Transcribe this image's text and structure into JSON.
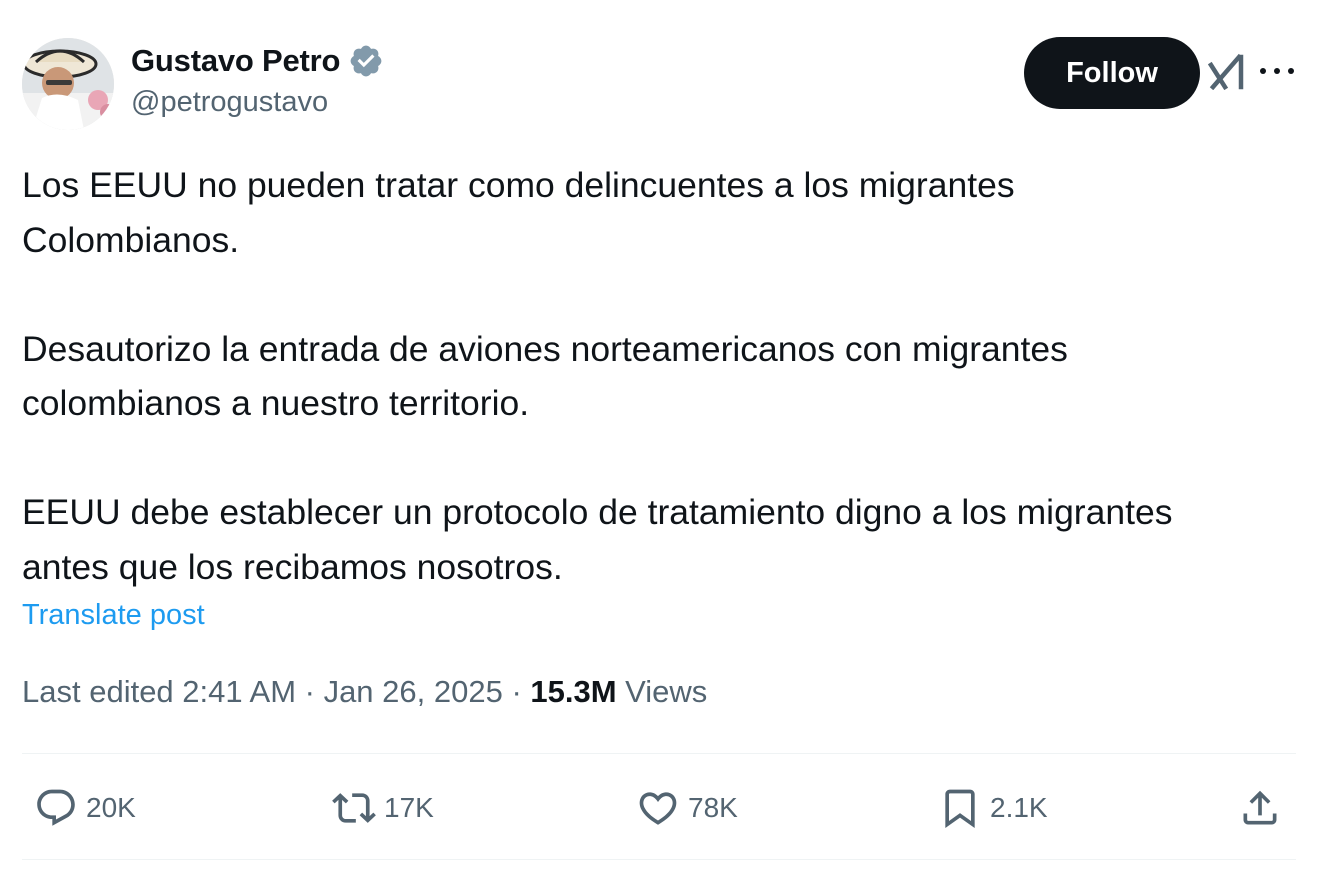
{
  "author": {
    "display_name": "Gustavo Petro",
    "handle": "@petrogustavo",
    "verified": true,
    "avatar_icon": "profile-photo"
  },
  "header": {
    "follow_label": "Follow",
    "grok_icon": "grok-icon",
    "more_icon": "more-icon"
  },
  "post": {
    "paragraphs": [
      [
        "Los EEUU no pueden tratar como delincuentes a los migrantes",
        "Colombianos."
      ],
      [
        "Desautorizo la entrada de aviones norteamericanos con migrantes",
        "colombianos a nuestro territorio."
      ],
      [
        "EEUU debe establecer un protocolo de tratamiento digno a los migrantes",
        "antes que los recibamos nosotros."
      ]
    ],
    "translate_label": "Translate post"
  },
  "meta": {
    "edited_prefix": "Last edited 2:41 AM · Jan 26, 2025 · ",
    "views_count": "15.3M",
    "views_label": " Views"
  },
  "actions": {
    "replies": "20K",
    "reposts": "17K",
    "likes": "78K",
    "bookmarks": "2.1K"
  },
  "colors": {
    "text": "#0f1419",
    "secondary": "#536471",
    "link": "#1d9bf0",
    "verified_badge": "#829aab"
  }
}
